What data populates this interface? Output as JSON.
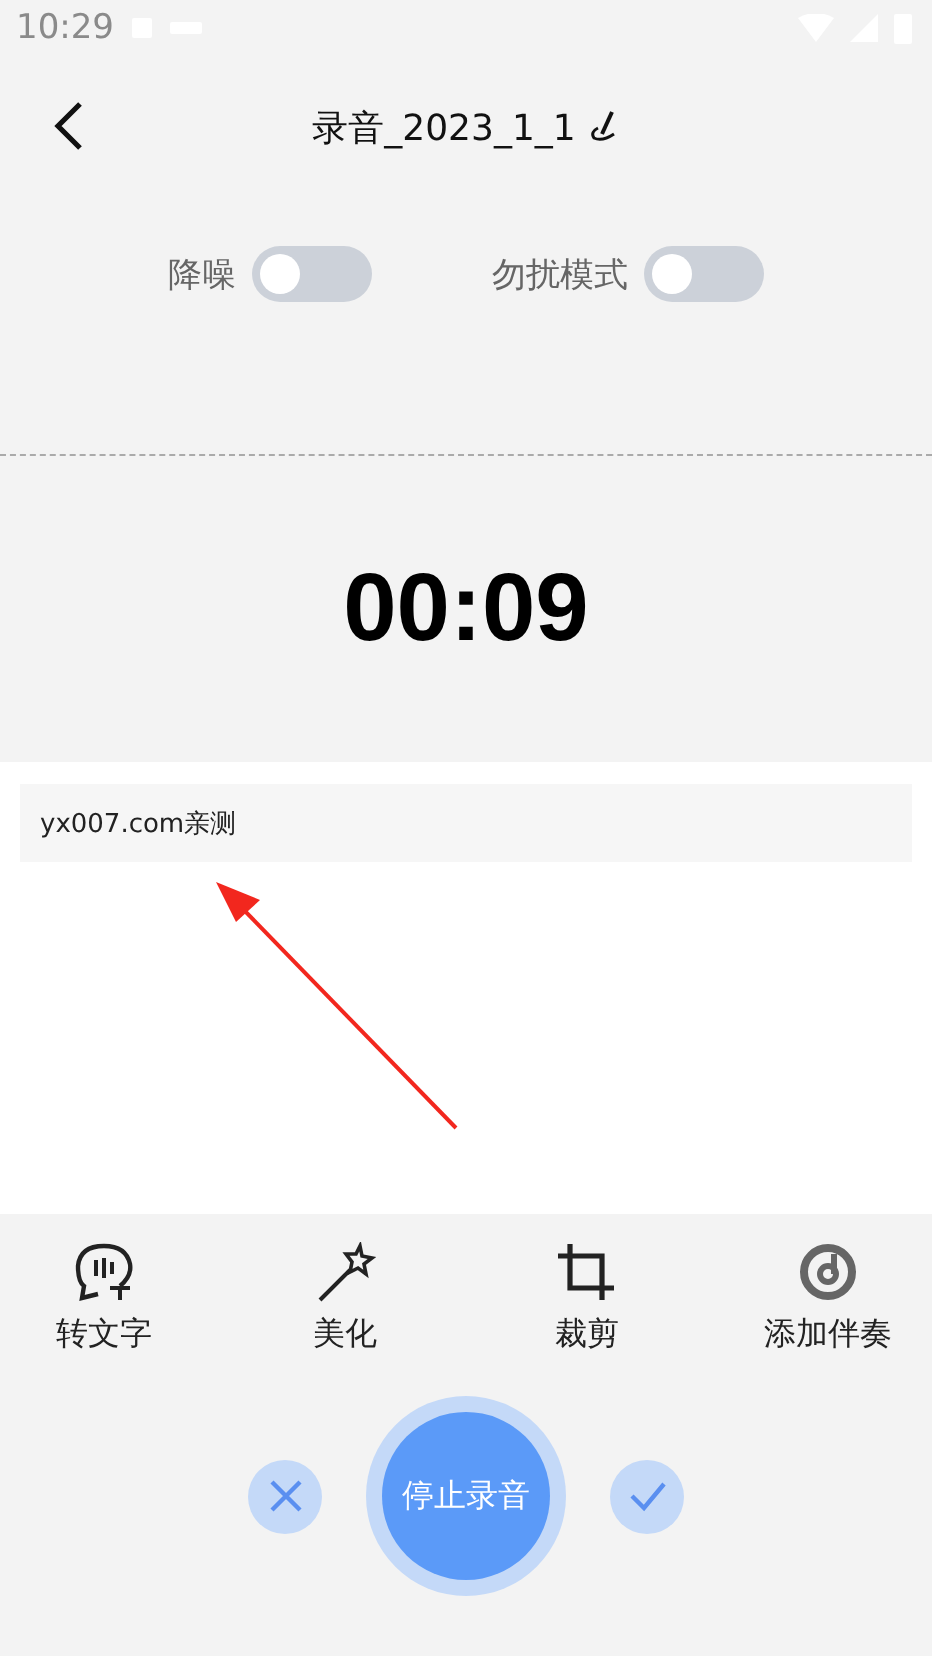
{
  "status_bar": {
    "time": "10:29"
  },
  "header": {
    "title": "录音_2023_1_1"
  },
  "toggles": [
    {
      "label": "降噪",
      "on": false
    },
    {
      "label": "勿扰模式",
      "on": false
    }
  ],
  "timer": "00:09",
  "note": {
    "text": "yx007.com亲测"
  },
  "tools": [
    {
      "kind": "transcribe",
      "label": "转文字"
    },
    {
      "kind": "beautify",
      "label": "美化"
    },
    {
      "kind": "crop",
      "label": "裁剪"
    },
    {
      "kind": "accompany",
      "label": "添加伴奏"
    }
  ],
  "controls": {
    "stop_label": "停止录音"
  }
}
